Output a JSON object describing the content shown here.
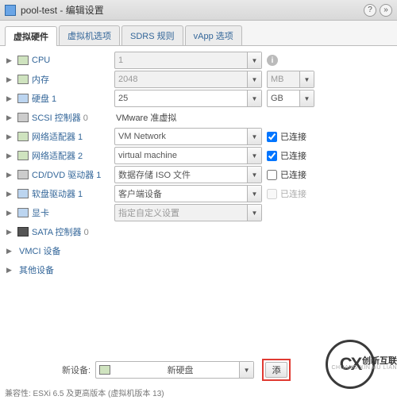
{
  "titlebar": {
    "title": "pool-test - 编辑设置",
    "help": "?",
    "close": "»"
  },
  "tabs": [
    "虚拟硬件",
    "虚拟机选项",
    "SDRS 规则",
    "vApp 选项"
  ],
  "rows": {
    "cpu": {
      "label": "CPU",
      "value": "1"
    },
    "mem": {
      "label": "内存",
      "value": "2048",
      "unit": "MB"
    },
    "disk": {
      "label": "硬盘 1",
      "value": "25",
      "unit": "GB"
    },
    "scsi": {
      "label": "SCSI 控制器",
      "count": "0",
      "value": "VMware 准虚拟"
    },
    "nic1": {
      "label": "网络适配器 1",
      "value": "VM Network",
      "connected": "已连接"
    },
    "nic2": {
      "label": "网络适配器 2",
      "value": "virtual machine",
      "connected": "已连接"
    },
    "cd": {
      "label": "CD/DVD 驱动器 1",
      "value": "数据存储 ISO 文件",
      "connected": "已连接"
    },
    "floppy": {
      "label": "软盘驱动器 1",
      "value": "客户端设备",
      "connected": "已连接"
    },
    "video": {
      "label": "显卡",
      "value": "指定自定义设置"
    },
    "sata": {
      "label": "SATA 控制器",
      "count": "0"
    },
    "vmci": {
      "label": "VMCI 设备"
    },
    "other": {
      "label": "其他设备"
    }
  },
  "bottom": {
    "label": "新设备:",
    "value": "新硬盘",
    "add": "添"
  },
  "compat": "兼容性: ESXi 6.5 及更高版本 (虚拟机版本 13)",
  "logo": {
    "mono": "CX",
    "cn": "创新互联",
    "en": "CHUANG XIN HU LIAN"
  }
}
